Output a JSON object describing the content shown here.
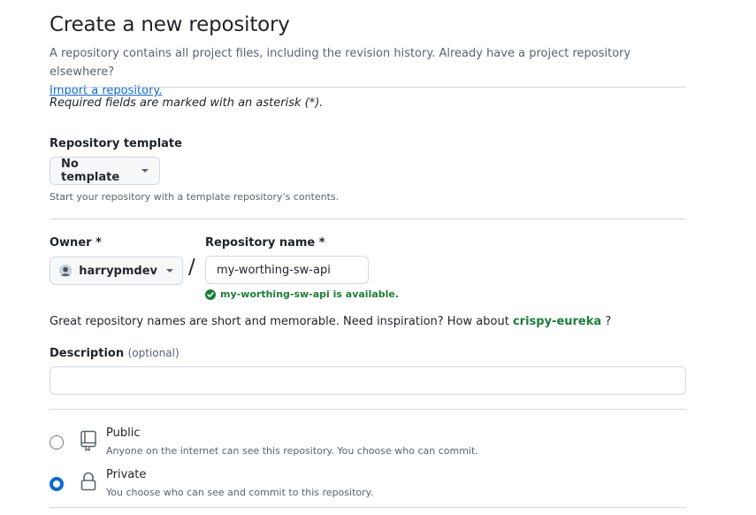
{
  "header": {
    "title": "Create a new repository",
    "intro": "A repository contains all project files, including the revision history. Already have a project repository elsewhere?",
    "import_link": "Import a repository."
  },
  "required_note": "Required fields are marked with an asterisk (*).",
  "template": {
    "label": "Repository template",
    "selected": "No template",
    "hint": "Start your repository with a template repository's contents."
  },
  "owner": {
    "label": "Owner *",
    "selected": "harrypmdev"
  },
  "separator": "/",
  "repo_name": {
    "label": "Repository name *",
    "value": "my-worthing-sw-api",
    "availability": "my-worthing-sw-api is available."
  },
  "inspiration": {
    "text": "Great repository names are short and memorable. Need inspiration? How about",
    "suggestion": "crispy-eureka",
    "suffix": "?"
  },
  "description": {
    "label": "Description",
    "optional": "(optional)",
    "value": ""
  },
  "visibility": {
    "selected": "private",
    "options": [
      {
        "title": "Public",
        "desc": "Anyone on the internet can see this repository. You choose who can commit."
      },
      {
        "title": "Private",
        "desc": "You choose who can see and commit to this repository."
      }
    ]
  },
  "colors": {
    "accent": "#0969da",
    "success": "#1a7f37",
    "border": "#d1d9e0",
    "muted_text": "#59636e"
  },
  "icons": [
    "check-circle-icon",
    "repo-icon",
    "lock-icon",
    "caret-down-icon",
    "avatar"
  ]
}
